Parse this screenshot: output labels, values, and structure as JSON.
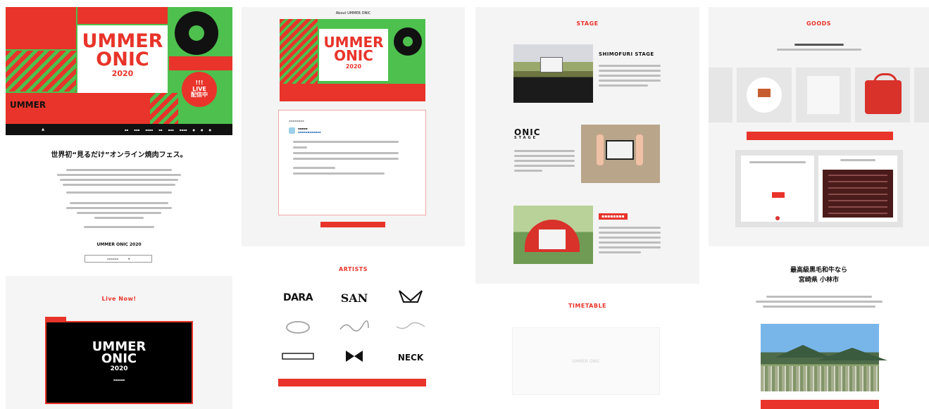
{
  "colors": {
    "accent": "#e8342a",
    "green": "#4ec04e",
    "dark": "#111111"
  },
  "panel1": {
    "hero_wordmark_line1": "UMMER",
    "hero_wordmark_line2": "ONIC",
    "hero_year": "2020",
    "hero_badge": "!!!\nLIVE\n配信中",
    "hero_band_text": "UMMER",
    "tagline": "世界初“見るだけ”オンライン焼肉フェス。",
    "brand_line": "UMMER ONIC 2020",
    "live_title": "Live Now!",
    "live_wordmark_line1": "UMMER",
    "live_wordmark_line2": "ONIC",
    "live_year": "2020"
  },
  "panel2": {
    "about_label": "About UMMER ONIC",
    "hero_wordmark_line1": "UMMER",
    "hero_wordmark_line2": "ONIC",
    "hero_year": "2020",
    "artists_title": "ARTISTS",
    "artist_logos": [
      "DARA",
      "SAN",
      "NECK"
    ]
  },
  "panel3": {
    "stage_title": "STAGE",
    "stage1_name": "SHIMOFURI STAGE",
    "stage2_logo_line1": "ONIC",
    "stage2_logo_line2": "STAGE",
    "timetable_title": "TIMETABLE",
    "timetable_placeholder": "UMMER ONIC"
  },
  "panel4": {
    "goods_title": "GOODS",
    "town_title_line1": "最高級黒毛和牛なら",
    "town_title_line2": "宮崎県 小林市"
  }
}
